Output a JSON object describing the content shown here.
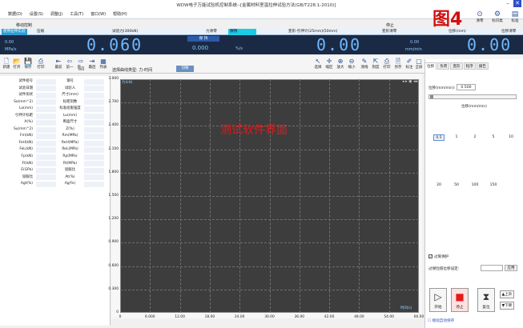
{
  "window": {
    "title": "WDW电子万能试验机控制系统--[金属材料室温拉伸试验方法(GB/T228.1-2010)]",
    "figure_label": "图4"
  },
  "menu": [
    "数据(D)",
    "设置(S)",
    "调整(J)",
    "工具(T)",
    "窗口(W)",
    "帮助(H)"
  ],
  "submenu": "移动控制",
  "status_word": "停止",
  "top_right_tools": [
    {
      "icon": "connect-icon",
      "label": "清零"
    },
    {
      "icon": "calibrate-icon",
      "label": "标识类"
    },
    {
      "icon": "standard-icon",
      "label": "标准"
    }
  ],
  "header_strip": {
    "btn_tensile": "使用拉伸实验",
    "compress": "压缩",
    "force_label": "试验力(300kN)",
    "force_zero": "力清零",
    "hold": "保持",
    "deform_label": "变形-引伸计(25mm)(50mm)",
    "deform_zero": "变形清零",
    "disp_label": "位移(mm)",
    "disp_zero": "位移清零"
  },
  "display": {
    "stress_val": "0.00",
    "stress_unit": "MPa/s",
    "force": "0.060",
    "mode_label": "保 持",
    "mode_val": "0.000",
    "mode_unit": "%/s",
    "deform": "0.00",
    "deform_rate": "0.00",
    "deform_rate_unit": "mm/min",
    "disp": "0.00"
  },
  "toolbar": [
    {
      "icon": "new-icon",
      "label": "新建"
    },
    {
      "icon": "open-icon",
      "label": "打开"
    },
    {
      "icon": "save-icon",
      "label": "保存"
    },
    {
      "icon": "print-icon",
      "label": "打印"
    },
    {
      "icon": "first-icon",
      "label": "最前"
    },
    {
      "icon": "prev-icon",
      "label": "前一"
    },
    {
      "icon": "next-icon",
      "label": "后一"
    },
    {
      "icon": "last-icon",
      "label": "最后"
    },
    {
      "icon": "list-icon",
      "label": "列表"
    }
  ],
  "page_counter": "0/0",
  "curve_type_label": "选择曲线类型:",
  "curve_type_value": "力-时间",
  "curve_type_btn": "切换",
  "plot_tools": [
    {
      "icon": "select-icon",
      "label": "选择"
    },
    {
      "icon": "zoom-icon",
      "label": "缩区"
    },
    {
      "icon": "zoomin-icon",
      "label": "放大"
    },
    {
      "icon": "restore-icon",
      "label": "缩小"
    },
    {
      "icon": "measure-icon",
      "label": "测线"
    },
    {
      "icon": "rescale-icon",
      "label": "刻度"
    },
    {
      "icon": "print-plot-icon",
      "label": "打印"
    },
    {
      "icon": "export-icon",
      "label": "另存"
    },
    {
      "icon": "note-icon",
      "label": "标注"
    },
    {
      "icon": "fullscreen-icon",
      "label": "全屏"
    }
  ],
  "params_left": [
    "试件组号",
    "试验日期",
    "试件形状",
    "So(mm^2)",
    "Lo(mm)",
    "引伸计标距",
    "A(%)",
    "Su(mm^2)",
    "Fm(kN)",
    "FeH(kN)",
    "FeL(kN)",
    "Fp(kN)",
    "Ft(kN)",
    "E(GPa)",
    "屈服比",
    "Agt(%)"
  ],
  "params_right": [
    "钢号",
    "试验人",
    "尺寸(mm)",
    "标距刻数",
    "标准屈服强度",
    "Lu(mm)",
    "断面尺寸",
    "Z(%)",
    "Rm(MPa)",
    "ReH(MPa)",
    "ReL(MPa)",
    "Rp(MPa)",
    "Rt(MPa)",
    "屈服比",
    "At(%)",
    "Ag(%)"
  ],
  "plot": {
    "watermark": "测试软件界面",
    "y_axis_title": "力(kN)",
    "x_axis_title": "时间(s)",
    "y_ticks": [
      "3.000",
      "2.700",
      "2.400",
      "2.100",
      "1.800",
      "1.500",
      "1.200",
      "0.900",
      "0.600",
      "0.300",
      "0"
    ],
    "x_ticks": [
      "0",
      "6.000",
      "12.00",
      "18.00",
      "24.00",
      "30.00",
      "36.00",
      "42.00",
      "48.00",
      "54.00",
      "60.00"
    ]
  },
  "right_tabs": [
    "位移",
    "负荷",
    "变形",
    "程序",
    "报告"
  ],
  "speed": {
    "label": "位移(mm/min):",
    "value": "0.500",
    "unit": "位移(mm/min)",
    "presets": [
      "0.5",
      "1",
      "2",
      "5",
      "10",
      "20",
      "50",
      "100",
      "150"
    ]
  },
  "limit_check": "✓",
  "limit_label": "过限保护",
  "maxforce_label": "过保险值位移设定:",
  "apply_btn": "应用",
  "actions": {
    "start": "开始",
    "stop": "停止",
    "reset": "复位",
    "up": "上升",
    "down": "下降"
  },
  "bottom_check": "继续自动保存"
}
